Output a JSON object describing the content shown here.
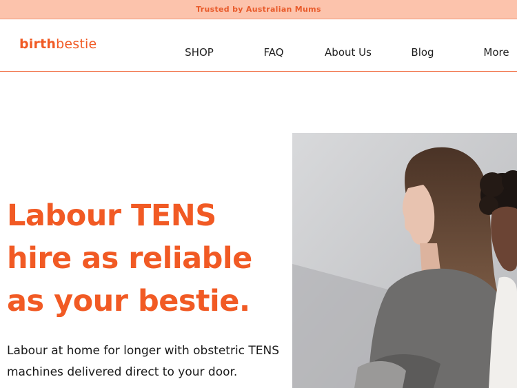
{
  "announcement": {
    "text": "Trusted by Australian Mums"
  },
  "logo": {
    "part1": "birth",
    "part2": "bestie"
  },
  "nav": [
    {
      "label": "SHOP"
    },
    {
      "label": "FAQ"
    },
    {
      "label": "About Us"
    },
    {
      "label": "Blog"
    },
    {
      "label": "More"
    }
  ],
  "hero": {
    "title": "Labour TENS hire as reliable as your bestie.",
    "subtitle": "Labour at home for longer with obstetric TENS machines delivered direct to your door.",
    "image": {
      "subject": "two women leaning against a light wall"
    }
  },
  "colors": {
    "accent": "#f15a24",
    "announcement_bg": "#fcc3ac",
    "text_dark": "#1b1b1b"
  }
}
